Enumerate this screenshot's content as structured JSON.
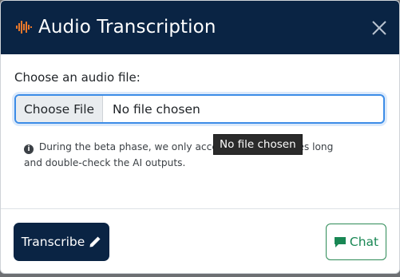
{
  "header": {
    "title": "Audio Transcription",
    "icon": "audio-wave-icon",
    "close_icon": "close-icon"
  },
  "form": {
    "label": "Choose an audio file:",
    "choose_button_label": "Choose File",
    "file_name": "No file chosen"
  },
  "tooltip": "No file chosen",
  "note": {
    "before": "During the beta phase, we only accep",
    "after": "s up to 2 minutes long and double-check the AI outputs."
  },
  "footer": {
    "transcribe_label": "Transcribe",
    "chat_label": "Chat"
  },
  "colors": {
    "header_bg": "#0a2444",
    "accent_orange": "#e8782a",
    "focus_blue": "#3c8ce7",
    "chat_green": "#198754"
  }
}
